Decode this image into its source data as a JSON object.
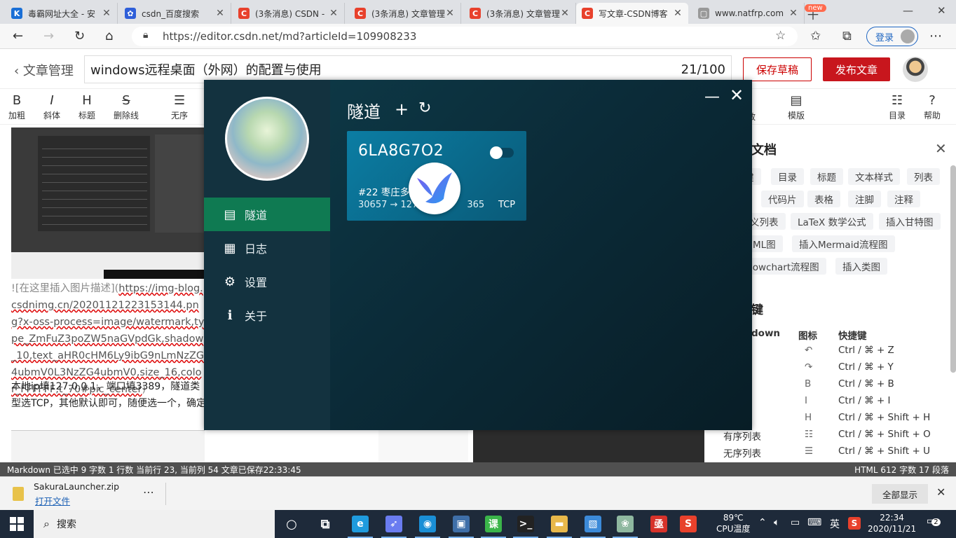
{
  "browser": {
    "tabs": [
      {
        "title": "毒霸网址大全 - 安",
        "icon": "k-logo-icon",
        "color": "#1a6fd6",
        "glyph": "K"
      },
      {
        "title": "csdn_百度搜索",
        "icon": "baidu-paw-icon",
        "color": "#2f5fd9",
        "glyph": "✿"
      },
      {
        "title": "(3条消息) CSDN -",
        "icon": "csdn-icon",
        "color": "#e8412c",
        "glyph": "C"
      },
      {
        "title": "(3条消息) 文章管理",
        "icon": "csdn-icon",
        "color": "#e8412c",
        "glyph": "C"
      },
      {
        "title": "(3条消息) 文章管理",
        "icon": "csdn-icon",
        "color": "#e8412c",
        "glyph": "C"
      },
      {
        "title": "写文章-CSDN博客",
        "icon": "csdn-icon",
        "color": "#e8412c",
        "glyph": "C"
      },
      {
        "title": "www.natfrp.com",
        "icon": "page-icon",
        "color": "#999999",
        "glyph": "▢"
      }
    ],
    "url": "https://editor.csdn.net/md?articleId=109908233",
    "login_label": "登录"
  },
  "editor": {
    "back_label": "文章管理",
    "article_title": "windows远程桌面（外网）的配置与使用",
    "title_count": "21/100",
    "save_draft": "保存草稿",
    "publish": "发布文章",
    "toolbar": [
      {
        "glyph": "B",
        "label": "加粗",
        "icon": "bold-icon"
      },
      {
        "glyph": "I",
        "label": "斜体",
        "icon": "italic-icon"
      },
      {
        "glyph": "H",
        "label": "标题",
        "icon": "heading-icon"
      },
      {
        "glyph": "S",
        "label": "删除线",
        "icon": "strikethrough-icon"
      },
      {
        "glyph": "☰",
        "label": "无序",
        "icon": "unordered-list-icon"
      },
      {
        "glyph": "▤",
        "label": "模版",
        "icon": "template-icon"
      },
      {
        "glyph": "☷",
        "label": "目录",
        "icon": "toc-icon"
      },
      {
        "glyph": "?",
        "label": "帮助",
        "icon": "help-icon"
      }
    ],
    "new_badge": "new",
    "toolbar_partial": "效"
  },
  "content": {
    "md_prefix": "![在这里插入图片描述](",
    "md_link": "https://img-blog.csdnimg.cn/20201121223153144.png?x-oss-process=image/watermark,type_ZmFuZ3poZW5naGVpdGk,shadow_10,text_aHR0cHM6Ly9ibG9nLmNzZG4ubmV0L3NzZG4ubmV0,size_16,color_FFFFFF,t_70#pic_center",
    "md_suffix": ")",
    "paragraph": "本地ip填127.0.0.1，端口填3389，隧道类型选TCP，其他默认即可，随便选一个，确定"
  },
  "help_panel": {
    "title": "文档",
    "chips": [
      [
        "键",
        "目录",
        "标题",
        "文本样式",
        "列表"
      ],
      [
        "",
        "代码片",
        "表格",
        "注脚",
        "注释"
      ],
      [
        "义列表",
        "LaTeX 数学公式",
        "插入甘特图"
      ],
      [
        "JML图",
        "插入Mermaid流程图"
      ],
      [
        "lowchart流程图",
        "插入类图"
      ]
    ],
    "shortcut_title": "键",
    "col_markdown": "down",
    "col_icon": "图标",
    "col_key": "快捷键",
    "shortcuts": [
      {
        "name": "",
        "glyph": "↶",
        "key": "Ctrl / ⌘ + Z"
      },
      {
        "name": "",
        "glyph": "↷",
        "key": "Ctrl / ⌘ + Y"
      },
      {
        "name": "",
        "glyph": "B",
        "key": "Ctrl / ⌘ + B"
      },
      {
        "name": "",
        "glyph": "I",
        "key": "Ctrl / ⌘ + I"
      },
      {
        "name": "",
        "glyph": "H",
        "key": "Ctrl / ⌘ + Shift + H"
      },
      {
        "name": "有序列表",
        "glyph": "☷",
        "key": "Ctrl / ⌘ + Shift + O"
      },
      {
        "name": "无序列表",
        "glyph": "☰",
        "key": "Ctrl / ⌘ + Shift + U"
      }
    ]
  },
  "status": {
    "left": "Markdown 已选中  9 字数  1 行数  当前行 23, 当前列 54  文章已保存22:33:45",
    "right": "HTML  612 字数  17 段落"
  },
  "app": {
    "nav": [
      {
        "label": "隧道",
        "icon": "server-icon",
        "glyph": "▤"
      },
      {
        "label": "日志",
        "icon": "log-icon",
        "glyph": "▦"
      },
      {
        "label": "设置",
        "icon": "gear-icon",
        "glyph": "⚙"
      },
      {
        "label": "关于",
        "icon": "info-icon",
        "glyph": "ℹ"
      }
    ],
    "active_nav": 0,
    "page_title": "隧道",
    "tunnel": {
      "name": "6LA8G7O2",
      "node": "#22 枣庄多",
      "ports": "30657 → 127",
      "ports_tail": "365",
      "protocol": "TCP",
      "enabled": false
    }
  },
  "download": {
    "filename": "SakuraLauncher.zip",
    "open_label": "打开文件",
    "show_all": "全部显示"
  },
  "taskbar": {
    "search_label": "搜索",
    "apps": [
      {
        "icon": "cortana-icon",
        "color": "transparent",
        "glyph": "○"
      },
      {
        "icon": "task-view-icon",
        "color": "transparent",
        "glyph": "⧉"
      },
      {
        "icon": "edge-icon",
        "color": "#1f9bde",
        "glyph": "e"
      },
      {
        "icon": "sakura-frp-icon",
        "color": "#6a7cf0",
        "glyph": "➶"
      },
      {
        "icon": "chat-app-icon",
        "color": "#1a8fd6",
        "glyph": "◉"
      },
      {
        "icon": "remote-desktop-icon",
        "color": "#3f6fa8",
        "glyph": "▣"
      },
      {
        "icon": "ke-app-icon",
        "color": "#3bb54a",
        "glyph": "课"
      },
      {
        "icon": "terminal-icon",
        "color": "#222222",
        "glyph": ">_"
      },
      {
        "icon": "folder-icon",
        "color": "#e8b84a",
        "glyph": "▬"
      },
      {
        "icon": "image-viewer-icon",
        "color": "#3c8ad8",
        "glyph": "▧"
      },
      {
        "icon": "anime-app-icon",
        "color": "#8fb8a0",
        "glyph": "❀"
      },
      {
        "icon": "jinshan-app-icon",
        "color": "#d7332b",
        "glyph": "亟"
      },
      {
        "icon": "wps-icon",
        "color": "#e8412c",
        "glyph": "S"
      }
    ],
    "temp_value": "89℃",
    "temp_label": "CPU温度",
    "ime": "英",
    "time": "22:34",
    "date": "2020/11/21",
    "notif_count": "2"
  }
}
